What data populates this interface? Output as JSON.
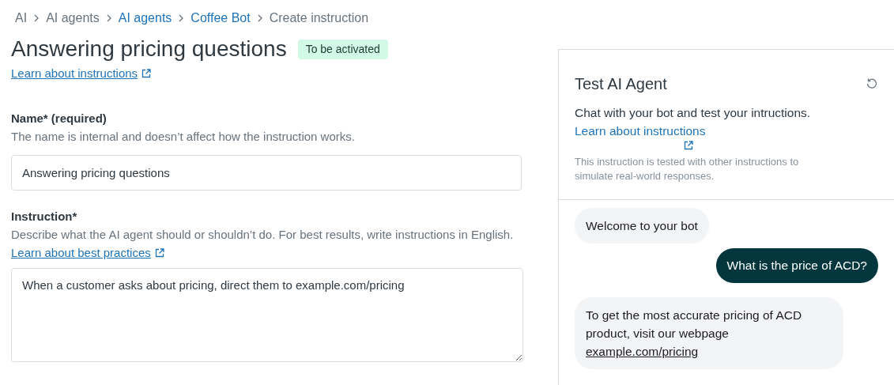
{
  "breadcrumb": [
    {
      "label": "AI",
      "kind": "plain"
    },
    {
      "label": "AI agents",
      "kind": "plain"
    },
    {
      "label": "AI agents",
      "kind": "link"
    },
    {
      "label": "Coffee Bot",
      "kind": "link"
    },
    {
      "label": "Create instruction",
      "kind": "plain"
    }
  ],
  "page": {
    "title": "Answering pricing questions",
    "status": "To be activated",
    "help_link": "Learn about instructions"
  },
  "fields": [
    {
      "kind": "input",
      "label": "Name* (required)",
      "description": "The name is internal and doesn’t affect how the instruction works.",
      "value": "Answering pricing questions"
    },
    {
      "kind": "textarea",
      "label": "Instruction*",
      "description": "Describe what the AI agent should or shouldn’t do. For best results, write instructions in English. ",
      "description_link": "Learn about best practices",
      "value": "When a customer asks about pricing, direct them to example.com/pricing"
    }
  ],
  "test_panel": {
    "title": "Test AI Agent",
    "description": "Chat with your bot and test your intructions. ",
    "description_link": "Learn about instructions",
    "note": "This instruction is tested with other instructions to simulate real-world responses.",
    "messages": [
      {
        "kind": "bot",
        "text": "Welcome to your bot"
      },
      {
        "kind": "user",
        "text": "What is the price of ACD?"
      },
      {
        "kind": "bot",
        "text": "To get the most accurate pricing of ACD product, visit our webpage ",
        "link": "example.com/pricing"
      }
    ]
  }
}
